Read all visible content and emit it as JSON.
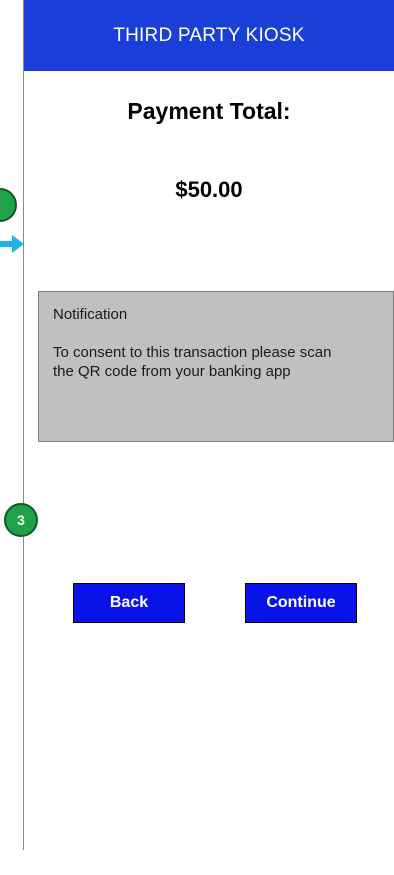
{
  "header": {
    "title": "THIRD PARTY KIOSK"
  },
  "payment": {
    "label": "Payment Total:",
    "amount": "$50.00"
  },
  "notification": {
    "title": "Notification",
    "message": "To consent to this transaction please scan the QR code from your banking app"
  },
  "buttons": {
    "back": "Back",
    "continue": "Continue"
  },
  "annotations": {
    "step_badge_label": "3"
  },
  "colors": {
    "header_bg": "#1a3fd8",
    "button_bg": "#0a14e8",
    "notification_bg": "#c0c0c0",
    "badge_bg": "#1ea34a",
    "arrow": "#1fb4e8"
  }
}
